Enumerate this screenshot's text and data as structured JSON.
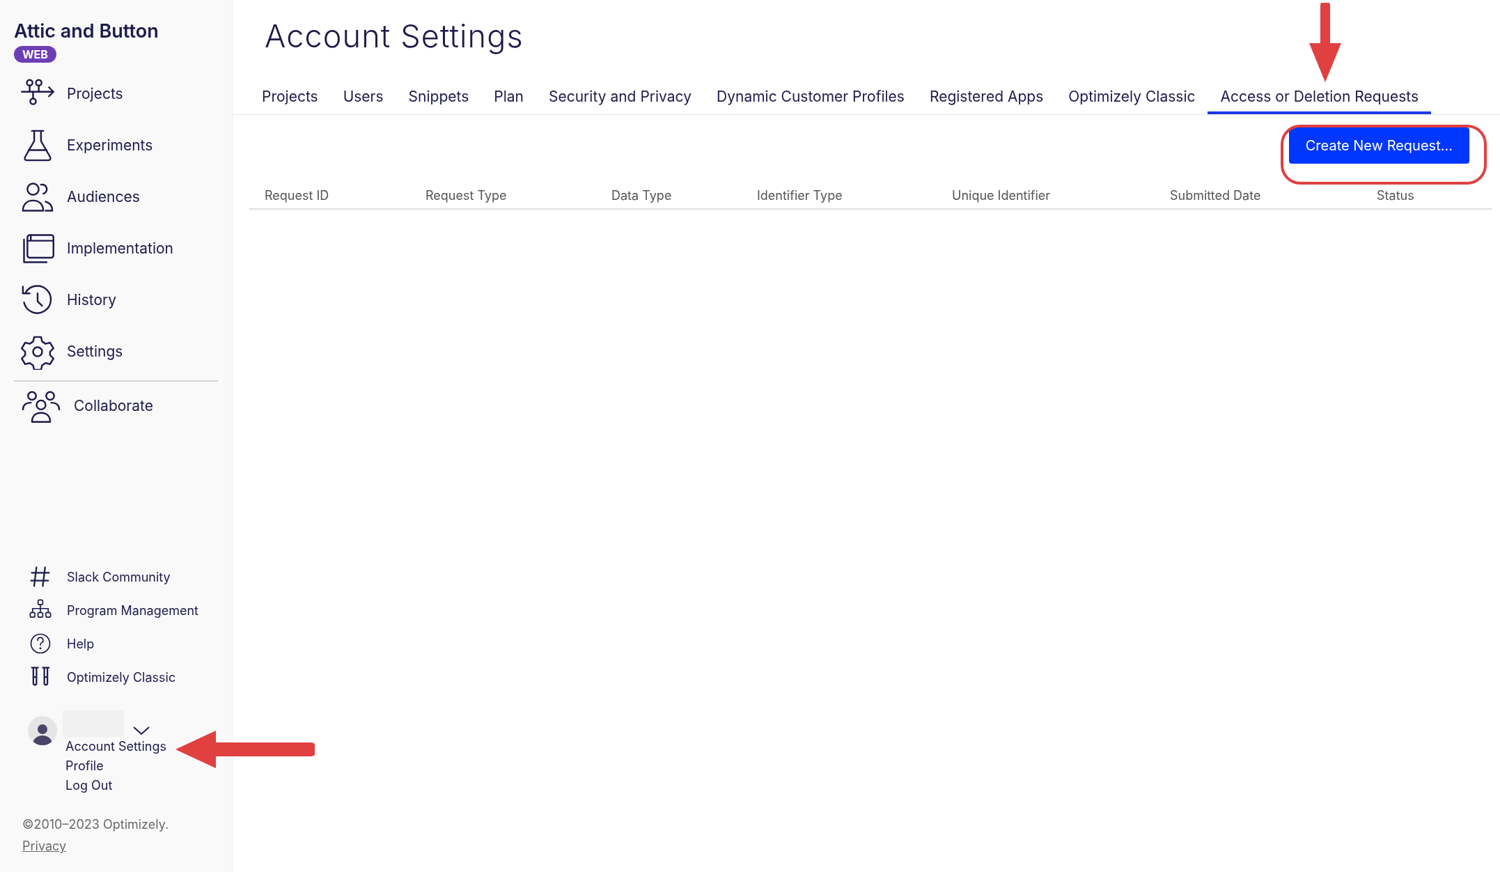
{
  "sidebar": {
    "title": "Attic and Button",
    "badge": "WEB",
    "items": [
      {
        "label": "Projects"
      },
      {
        "label": "Experiments"
      },
      {
        "label": "Audiences"
      },
      {
        "label": "Implementation"
      },
      {
        "label": "History"
      },
      {
        "label": "Settings"
      }
    ],
    "collab": {
      "label": "Collaborate"
    },
    "links": [
      {
        "label": "Slack Community"
      },
      {
        "label": "Program Management"
      },
      {
        "label": "Help"
      },
      {
        "label": "Optimizely Classic"
      }
    ],
    "user_menu": [
      {
        "label": "Account Settings"
      },
      {
        "label": "Profile"
      },
      {
        "label": "Log Out"
      }
    ],
    "copyright": "©2010–2023 Optimizely.",
    "privacy": "Privacy"
  },
  "main": {
    "title": "Account Settings",
    "tabs": [
      {
        "label": "Projects",
        "selected": false
      },
      {
        "label": "Users",
        "selected": false
      },
      {
        "label": "Snippets",
        "selected": false
      },
      {
        "label": "Plan",
        "selected": false
      },
      {
        "label": "Security and Privacy",
        "selected": false
      },
      {
        "label": "Dynamic Customer Profiles",
        "selected": false
      },
      {
        "label": "Registered Apps",
        "selected": false
      },
      {
        "label": "Optimizely Classic",
        "selected": false
      },
      {
        "label": "Access or Deletion Requests",
        "selected": true
      }
    ],
    "button": "Create New Request...",
    "table": {
      "columns": [
        "Request ID",
        "Request Type",
        "Data Type",
        "Identifier Type",
        "Unique Identifier",
        "Submitted Date",
        "Status"
      ]
    }
  }
}
